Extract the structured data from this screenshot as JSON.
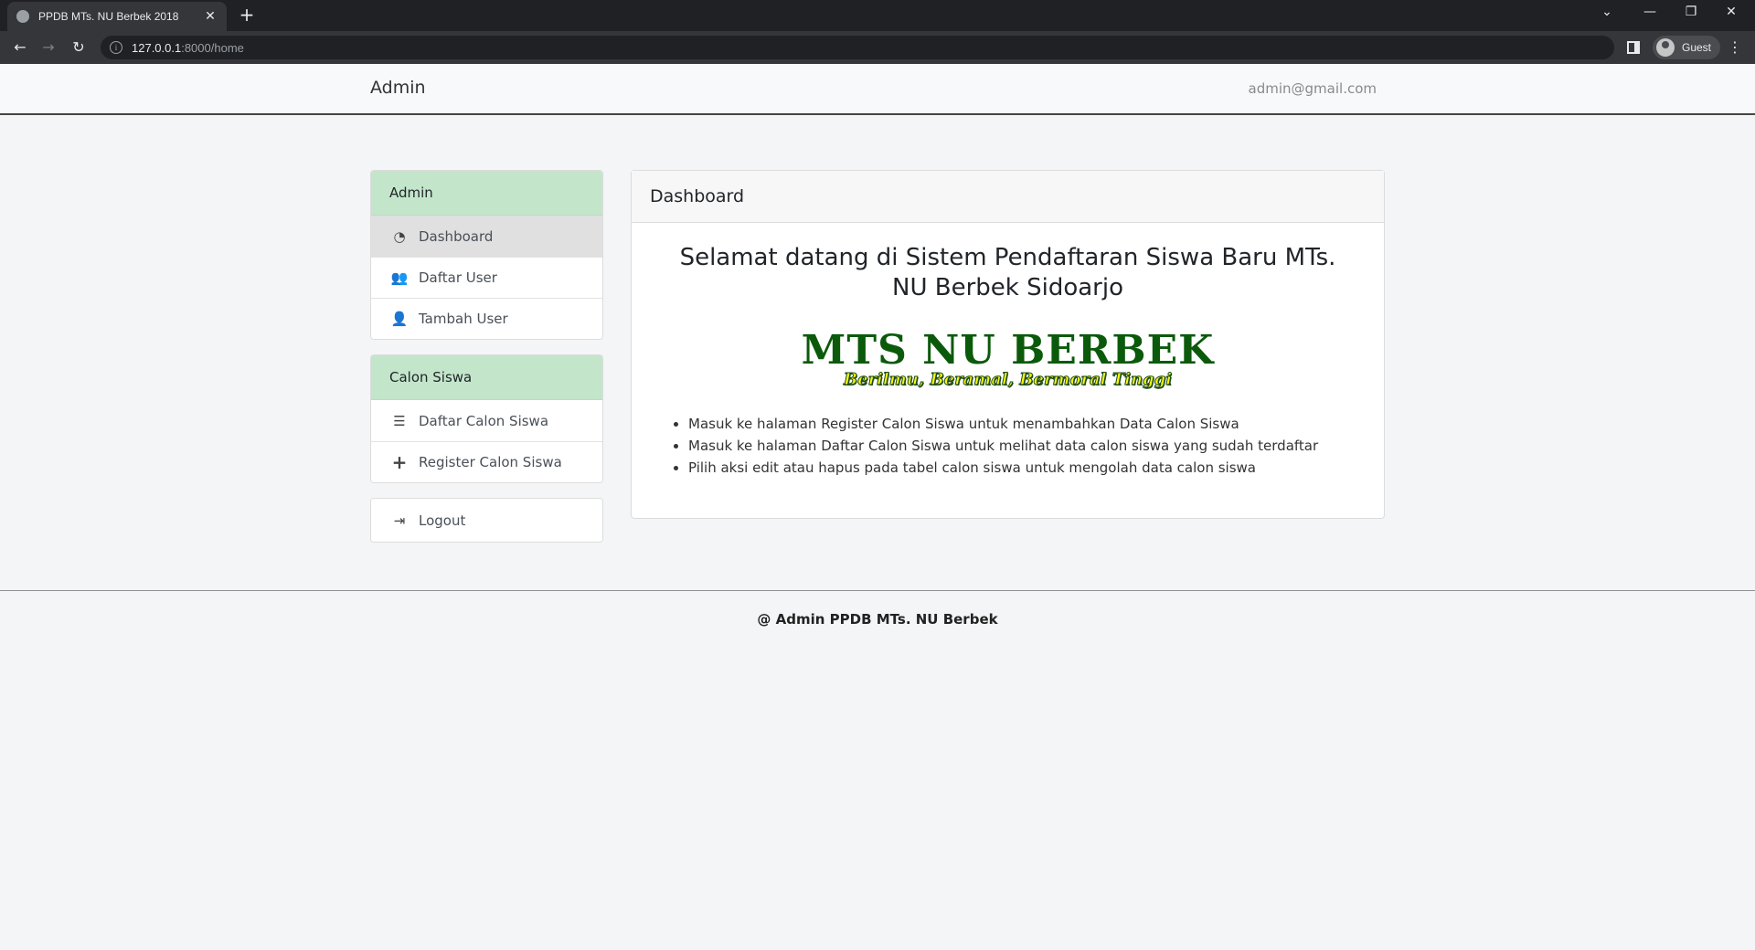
{
  "browser": {
    "tab_title": "PPDB MTs. NU Berbek 2018",
    "tab_close": "✕",
    "new_tab": "+",
    "url_host": "127.0.0.1",
    "url_path": ":8000/home",
    "profile_label": "Guest",
    "back": "←",
    "forward": "→",
    "reload": "↻",
    "menu": "⋮",
    "minimize": "—",
    "restore": "❐",
    "close": "✕",
    "tab_search": "⌄"
  },
  "navbar": {
    "brand": "Admin",
    "user_email": "admin@gmail.com"
  },
  "sidebar": {
    "admin_header": "Admin",
    "admin_items": [
      {
        "label": "Dashboard",
        "icon": "dashboard-icon",
        "glyph": "◔",
        "active": true
      },
      {
        "label": "Daftar User",
        "icon": "users-icon",
        "glyph": "👥",
        "active": false
      },
      {
        "label": "Tambah User",
        "icon": "user-plus-icon",
        "glyph": "👤",
        "active": false
      }
    ],
    "siswa_header": "Calon Siswa",
    "siswa_items": [
      {
        "label": "Daftar Calon Siswa",
        "icon": "list-icon",
        "glyph": "☰"
      },
      {
        "label": "Register Calon Siswa",
        "icon": "plus-icon",
        "glyph": "+"
      }
    ],
    "logout": {
      "label": "Logout",
      "icon": "sign-out-icon",
      "glyph": "⇥"
    }
  },
  "card": {
    "header": "Dashboard",
    "welcome": "Selamat datang di Sistem Pendaftaran Siswa Baru MTs. NU Berbek Sidoarjo",
    "logo_main": "MTS NU BERBEK",
    "logo_sub": "Berilmu, Beramal, Bermoral Tinggi",
    "bullets": [
      "Masuk ke halaman Register Calon Siswa untuk menambahkan Data Calon Siswa",
      "Masuk ke halaman Daftar Calon Siswa untuk melihat data calon siswa yang sudah terdaftar",
      "Pilih aksi edit atau hapus pada tabel calon siswa untuk mengolah data calon siswa"
    ]
  },
  "footer": {
    "text": "@ Admin PPDB MTs. NU Berbek"
  }
}
